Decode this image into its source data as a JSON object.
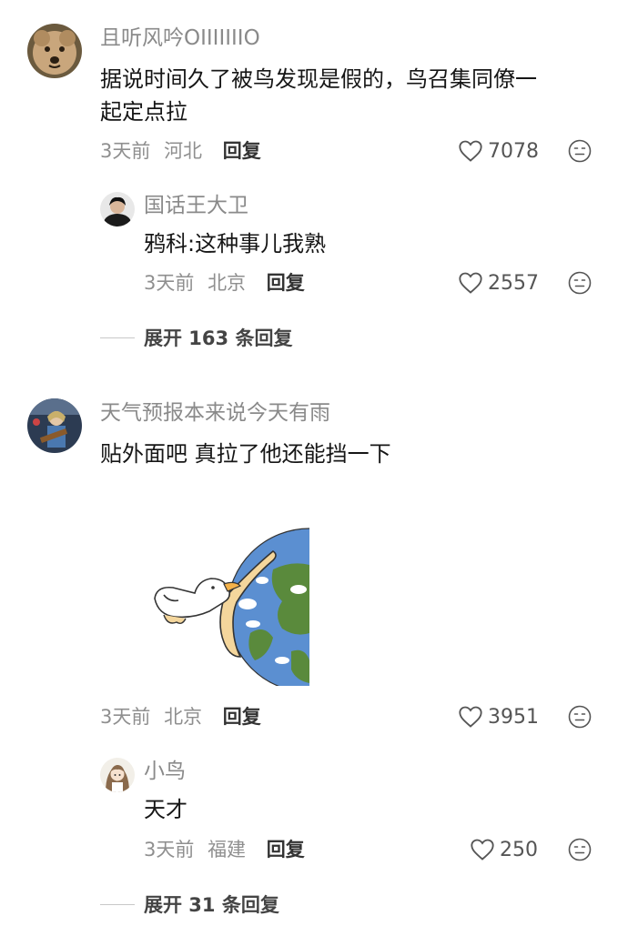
{
  "comments": [
    {
      "user": "且听风吟OIIIIIIIO",
      "text_lines": [
        "据说时间久了被鸟发现是假的，鸟召集同僚一",
        "起定点拉"
      ],
      "time": "3天前",
      "location": "河北",
      "reply_label": "回复",
      "likes": "7078",
      "replies": [
        {
          "user": "国话王大卫",
          "text": "鸦科:这种事儿我熟",
          "time": "3天前",
          "location": "北京",
          "reply_label": "回复",
          "likes": "2557"
        }
      ],
      "expand_label": "展开 163 条回复"
    },
    {
      "user": "天气预报本来说今天有雨",
      "text": "贴外面吧 真拉了他还能挡一下",
      "time": "3天前",
      "location": "北京",
      "reply_label": "回复",
      "likes": "3951",
      "replies": [
        {
          "user": "小鸟",
          "text": "天才",
          "time": "3天前",
          "location": "福建",
          "reply_label": "回复",
          "likes": "250"
        }
      ],
      "expand_label": "展开 31 条回复"
    }
  ],
  "icons": {
    "like": "heart-outline-icon",
    "dislike": "neutral-face-icon"
  },
  "colors": {
    "username": "#8a8a8a",
    "body_text": "#161616",
    "meta": "#8f8f8f",
    "earth_ocean": "#5b8fd1",
    "earth_land": "#5a8a3c"
  }
}
